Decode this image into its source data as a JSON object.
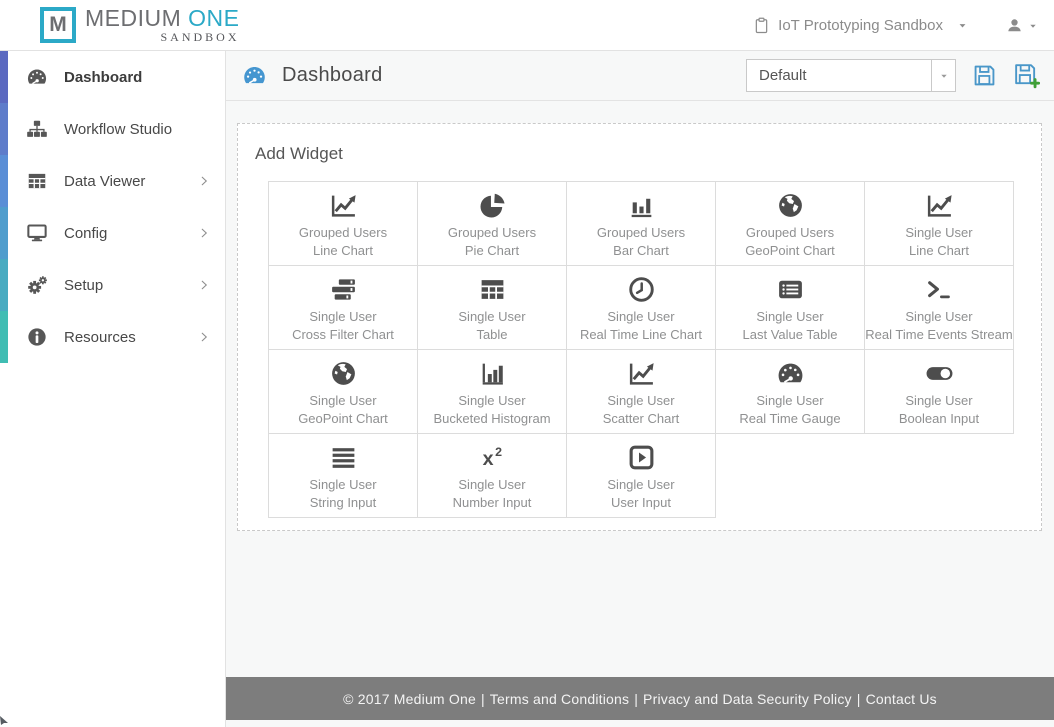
{
  "header": {
    "logo": {
      "mark": "M",
      "brand_primary": "MEDIUM",
      "brand_accent": "ONE",
      "brand_sub": "SANDBOX"
    },
    "sandbox_selector": {
      "label": "IoT Prototyping Sandbox",
      "icon": "clipboard"
    },
    "account": {
      "icon": "user"
    }
  },
  "sidebar": {
    "items": [
      {
        "label": "Dashboard",
        "icon": "tachometer",
        "active": true,
        "has_submenu": false,
        "strip_color": "#5b69c0"
      },
      {
        "label": "Workflow Studio",
        "icon": "sitemap",
        "active": false,
        "has_submenu": false,
        "strip_color": "#5e7cca"
      },
      {
        "label": "Data Viewer",
        "icon": "table",
        "active": false,
        "has_submenu": true,
        "strip_color": "#5a8ed6"
      },
      {
        "label": "Config",
        "icon": "desktop",
        "active": false,
        "has_submenu": true,
        "strip_color": "#509dcd"
      },
      {
        "label": "Setup",
        "icon": "gears",
        "active": false,
        "has_submenu": true,
        "strip_color": "#48abc1"
      },
      {
        "label": "Resources",
        "icon": "info-circle",
        "active": false,
        "has_submenu": true,
        "strip_color": "#40bdb3"
      }
    ]
  },
  "main": {
    "page_title": "Dashboard",
    "page_title_icon": "tachometer",
    "view_select": {
      "value": "Default"
    },
    "toolbar": {
      "save_icon": "save",
      "save_new_icon": "save-plus"
    },
    "panel": {
      "title": "Add Widget",
      "widgets": [
        {
          "group": "Grouped Users",
          "name": "Line Chart",
          "icon": "line-chart"
        },
        {
          "group": "Grouped Users",
          "name": "Pie Chart",
          "icon": "pie-chart"
        },
        {
          "group": "Grouped Users",
          "name": "Bar Chart",
          "icon": "bar-chart"
        },
        {
          "group": "Grouped Users",
          "name": "GeoPoint Chart",
          "icon": "globe"
        },
        {
          "group": "Single User",
          "name": "Line Chart",
          "icon": "line-chart"
        },
        {
          "group": "Single User",
          "name": "Cross Filter Chart",
          "icon": "cross-filter"
        },
        {
          "group": "Single User",
          "name": "Table",
          "icon": "table"
        },
        {
          "group": "Single User",
          "name": "Real Time Line Chart",
          "icon": "clock"
        },
        {
          "group": "Single User",
          "name": "Last Value Table",
          "icon": "list-alt"
        },
        {
          "group": "Single User",
          "name": "Real Time Events Stream",
          "icon": "terminal"
        },
        {
          "group": "Single User",
          "name": "GeoPoint Chart",
          "icon": "globe"
        },
        {
          "group": "Single User",
          "name": "Bucketed Histogram",
          "icon": "histogram"
        },
        {
          "group": "Single User",
          "name": "Scatter Chart",
          "icon": "line-chart"
        },
        {
          "group": "Single User",
          "name": "Real Time Gauge",
          "icon": "tachometer"
        },
        {
          "group": "Single User",
          "name": "Boolean Input",
          "icon": "toggle-on"
        },
        {
          "group": "Single User",
          "name": "String Input",
          "icon": "align-justify"
        },
        {
          "group": "Single User",
          "name": "Number Input",
          "icon": "superscript"
        },
        {
          "group": "Single User",
          "name": "User Input",
          "icon": "caret-square-right"
        }
      ]
    }
  },
  "footer": {
    "segments": [
      {
        "text": "© 2017 Medium One",
        "link": false
      },
      {
        "text": "Terms and Conditions",
        "link": true
      },
      {
        "text": "Privacy and Data Security Policy",
        "link": true
      },
      {
        "text": "Contact Us",
        "link": true
      }
    ],
    "separator": "|"
  },
  "colors": {
    "brand_teal": "#2ba9c7",
    "title_icon_blue": "#4596d0",
    "save_icon_blue": "#4a97c9",
    "save_plus_green": "#3f9f37",
    "footer_bg": "#7d7d7d"
  }
}
